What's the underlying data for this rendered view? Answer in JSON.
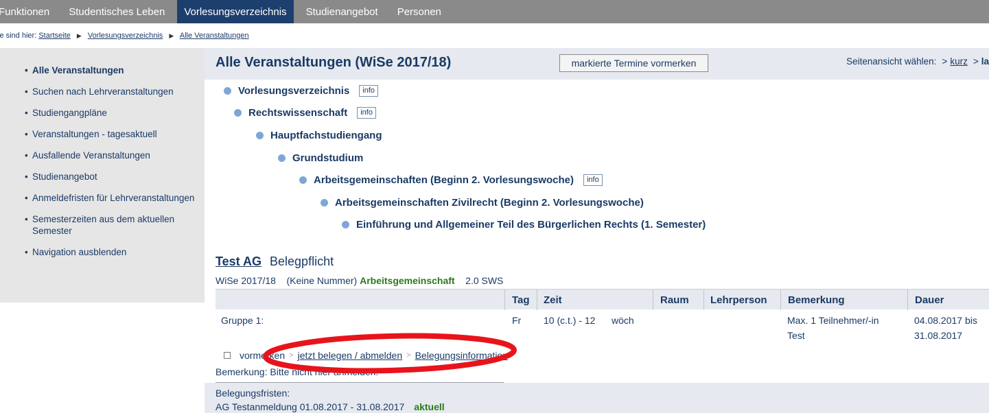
{
  "topnav": {
    "tabs": [
      {
        "label": "Funktionen"
      },
      {
        "label": "Studentisches Leben"
      },
      {
        "label": "Vorlesungsverzeichnis"
      },
      {
        "label": "Studienangebot"
      },
      {
        "label": "Personen"
      }
    ]
  },
  "breadcrumb": {
    "prefix": "ie sind hier:",
    "items": [
      "Startseite",
      "Vorlesungsverzeichnis",
      "Alle Veranstaltungen"
    ]
  },
  "sidebar": {
    "items": [
      {
        "label": "Alle Veranstaltungen"
      },
      {
        "label": "Suchen nach Lehrveranstaltungen"
      },
      {
        "label": "Studiengangpläne"
      },
      {
        "label": "Veranstaltungen - tagesaktuell"
      },
      {
        "label": "Ausfallende Veranstaltungen"
      },
      {
        "label": "Studienangebot"
      },
      {
        "label": "Anmeldefristen für Lehrveranstaltungen"
      },
      {
        "label": "Semesterzeiten aus dem aktuellen Semester"
      },
      {
        "label": "Navigation ausblenden"
      }
    ]
  },
  "header": {
    "title": "Alle Veranstaltungen (WiSe 2017/18)",
    "mark_button": "markierte Termine vormerken",
    "view_label": "Seitenansicht wählen:",
    "view_short": "kurz",
    "view_long_partial": "la"
  },
  "hierarchy": [
    {
      "label": "Vorlesungsverzeichnis",
      "info": "info"
    },
    {
      "label": "Rechtswissenschaft",
      "info": "info"
    },
    {
      "label": "Hauptfachstudiengang"
    },
    {
      "label": "Grundstudium"
    },
    {
      "label": "Arbeitsgemeinschaften (Beginn 2. Vorlesungswoche)",
      "info": "info"
    },
    {
      "label": "Arbeitsgemeinschaften Zivilrecht (Beginn 2. Vorlesungswoche)"
    },
    {
      "label": "Einführung und Allgemeiner Teil des Bürgerlichen Rechts (1. Semester)"
    }
  ],
  "course": {
    "name": "Test AG",
    "requirement": "Belegpflicht",
    "semester": "WiSe 2017/18",
    "number": "(Keine Nummer)",
    "type": "Arbeitsgemeinschaft",
    "sws": "2.0 SWS"
  },
  "table": {
    "headers": {
      "tag": "Tag",
      "zeit": "Zeit",
      "raum": "Raum",
      "lehrperson": "Lehrperson",
      "bemerkung": "Bemerkung",
      "dauer": "Dauer"
    },
    "row": {
      "gruppe": "Gruppe 1:",
      "tag": "Fr",
      "zeit": "10 (c.t.) - 12",
      "rhythmus": "wöch",
      "bemerkung_line1": "Max. 1 Teilnehmer/-in",
      "bemerkung_line2": "Test",
      "dauer_line1": "04.08.2017 bis",
      "dauer_line2": "31.08.2017"
    }
  },
  "actions": {
    "vormerken": "vormerken",
    "belegen": "jetzt belegen / abmelden",
    "info": "Belegungsinformation"
  },
  "remark": "Bemerkung: Bitte nicht hier anmelden!",
  "fristen": {
    "label": "Belegungsfristen:",
    "entry": "AG Testanmeldung 01.08.2017 - 31.08.2017",
    "status": "aktuell"
  },
  "colors": {
    "nav_bg": "#8a8a8a",
    "nav_active": "#1d3f6e",
    "link": "#1a3a66",
    "green": "#2a7a1a",
    "highlight": "#e8141b"
  }
}
